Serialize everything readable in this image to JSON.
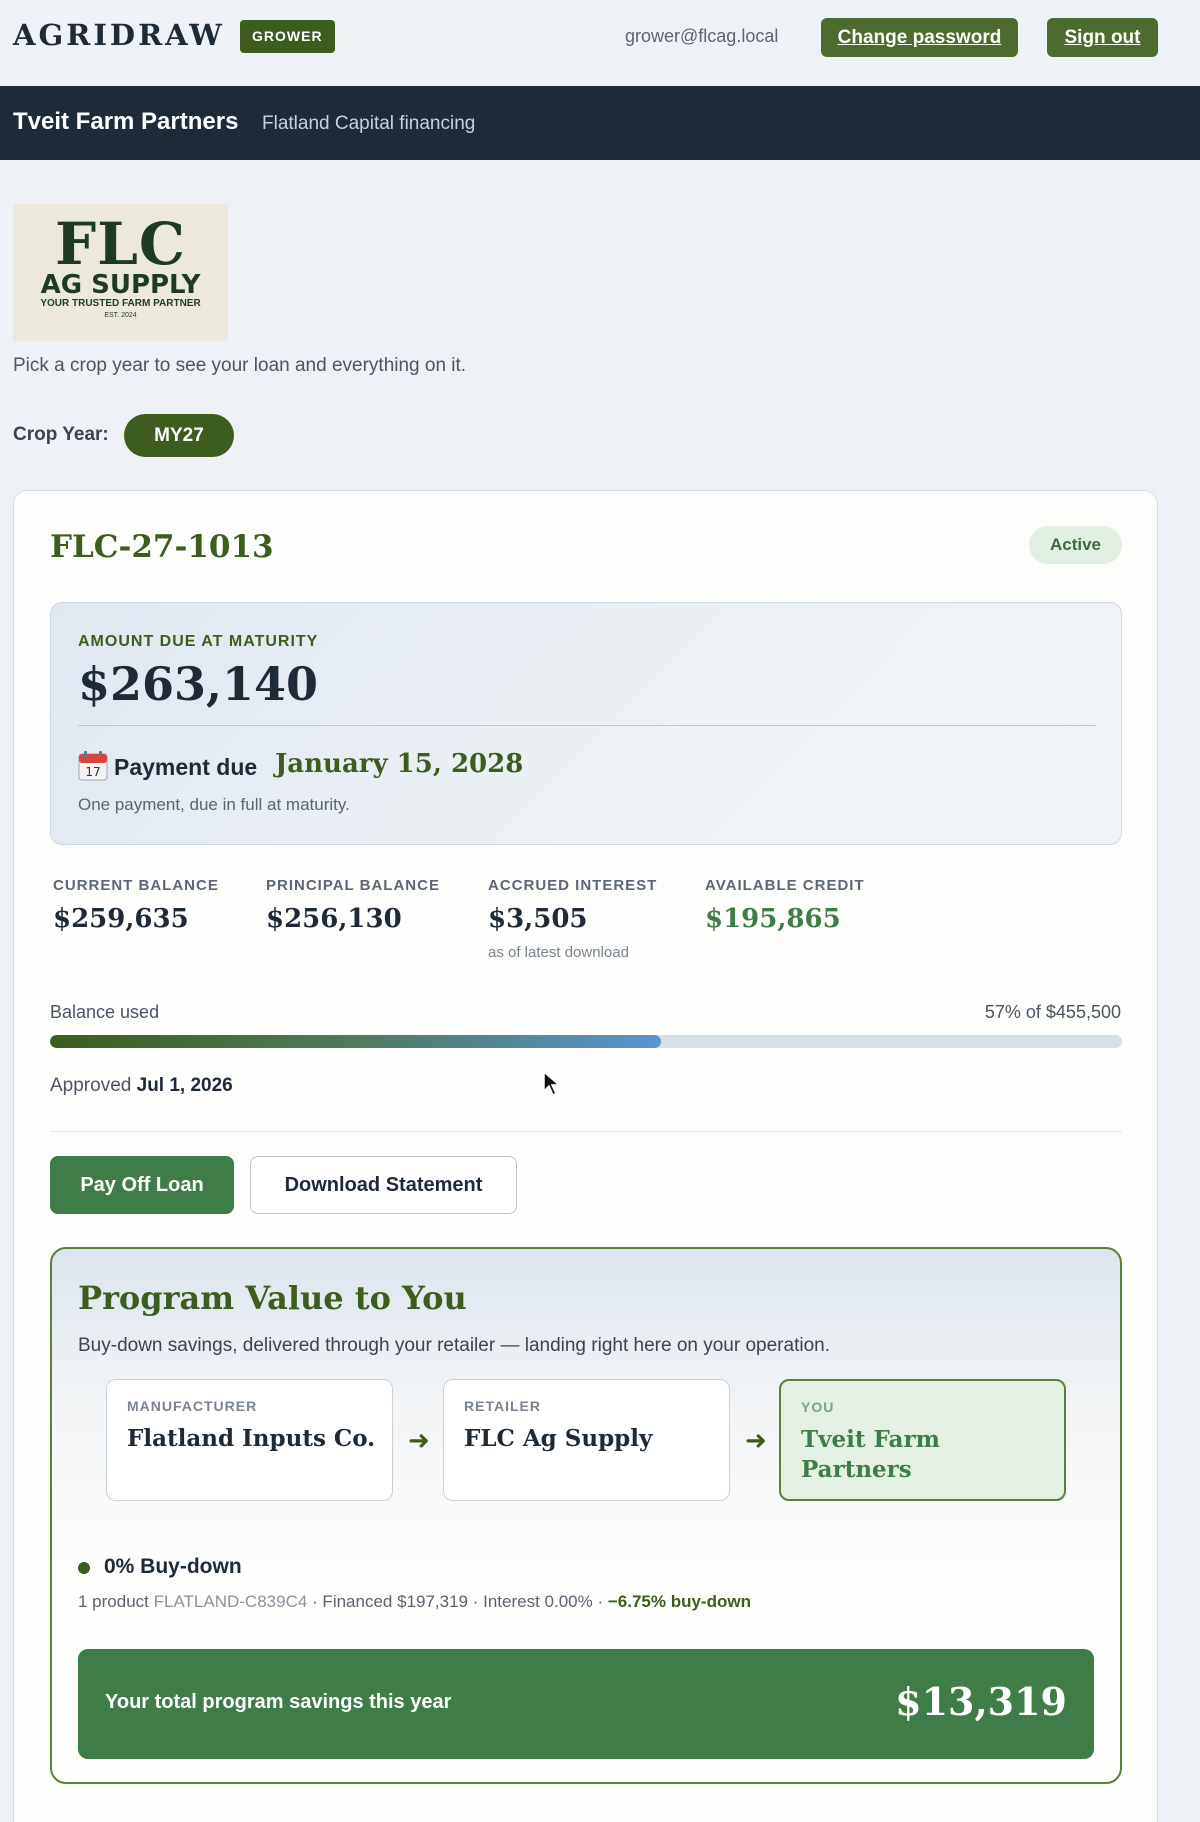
{
  "header": {
    "app_name": "AGRIDRAW",
    "role_badge": "GROWER",
    "user_email": "grower@flcag.local",
    "change_password_label": "Change password",
    "sign_out_label": "Sign out"
  },
  "band": {
    "title": "Tveit Farm Partners",
    "subtitle": "Flatland Capital financing"
  },
  "retailer_logo": {
    "line1": "FLC",
    "line2": "AG SUPPLY",
    "line3": "YOUR TRUSTED FARM PARTNER",
    "line4": "EST. 2024"
  },
  "instruction": "Pick a crop year to see your loan and everything on it.",
  "crop_year": {
    "label": "Crop Year:",
    "selected": "MY27"
  },
  "loan": {
    "id": "FLC-27-1013",
    "status": "Active",
    "amount_due_label": "AMOUNT DUE AT MATURITY",
    "amount_due": "$263,140",
    "payment_due_label": "Payment due",
    "payment_due_date": "January 15, 2028",
    "payment_note": "One payment, due in full at maturity.",
    "stats": [
      {
        "label": "CURRENT BALANCE",
        "value": "$259,635",
        "note": ""
      },
      {
        "label": "PRINCIPAL BALANCE",
        "value": "$256,130",
        "note": ""
      },
      {
        "label": "ACCRUED INTEREST",
        "value": "$3,505",
        "note": "as of latest download"
      },
      {
        "label": "AVAILABLE CREDIT",
        "value": "$195,865",
        "note": ""
      }
    ],
    "balance_used_label": "Balance used",
    "balance_used_text": "57% of $455,500",
    "balance_used_fraction": 0.57,
    "approved_label": "Approved",
    "approved_date": "Jul 1, 2026",
    "pay_off_label": "Pay Off Loan",
    "download_label": "Download Statement"
  },
  "program": {
    "title": "Program Value to You",
    "subtitle": "Buy-down savings, delivered through your retailer — landing right here on your operation.",
    "flow": [
      {
        "label": "MANUFACTURER",
        "value": "Flatland Inputs Co."
      },
      {
        "label": "RETAILER",
        "value": "FLC Ag Supply"
      },
      {
        "label": "YOU",
        "value": "Tveit Farm Partners"
      }
    ],
    "buydown_title": "0% Buy-down",
    "buydown_prefix": "1 product",
    "buydown_sku": "FLATLAND-C839C4",
    "buydown_details": "· Financed $197,319 · Interest 0.00% ·",
    "buydown_rate": "−6.75% buy-down",
    "total_label": "Your total program savings this year",
    "total_value": "$13,319"
  },
  "colors": {
    "brand_green": "#3d5d1e",
    "action_green": "#3f7d48",
    "dark_band": "#1e2a37"
  }
}
